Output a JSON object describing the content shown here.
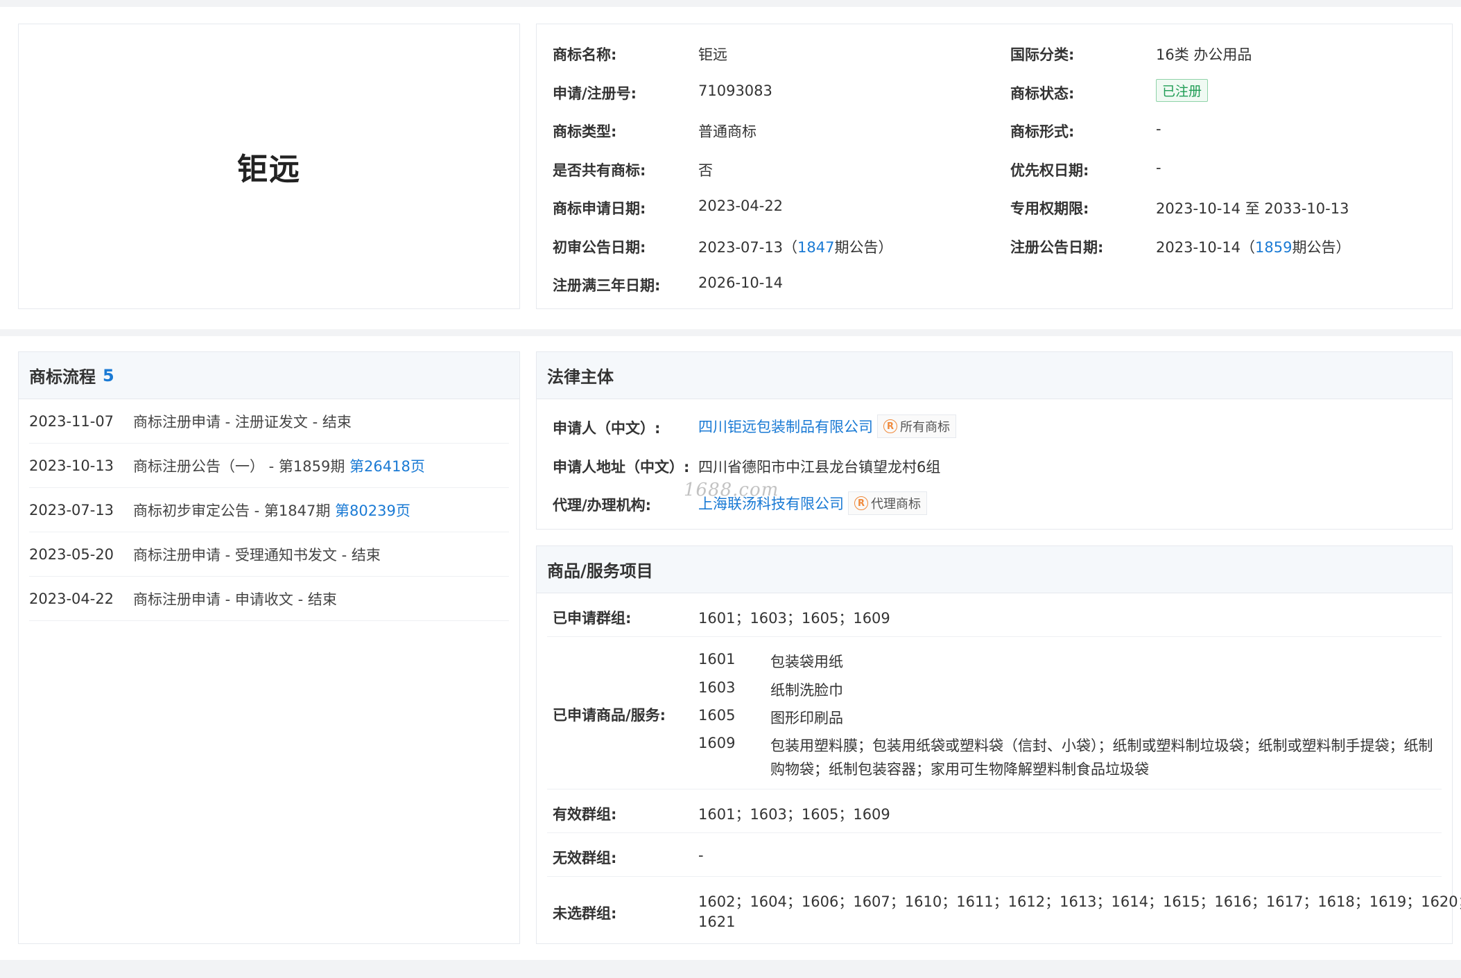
{
  "logo": {
    "text": "钜远"
  },
  "basic_info": {
    "left": [
      {
        "label": "商标名称:",
        "value": "钜远"
      },
      {
        "label": "申请/注册号:",
        "value": "71093083"
      },
      {
        "label": "商标类型:",
        "value": "普通商标"
      },
      {
        "label": "是否共有商标:",
        "value": "否"
      },
      {
        "label": "商标申请日期:",
        "value": "2023-04-22"
      },
      {
        "label": "初审公告日期:",
        "value_prefix": "2023-07-13（",
        "link": "1847",
        "value_suffix": "期公告）"
      },
      {
        "label": "注册满三年日期:",
        "value": "2026-10-14"
      }
    ],
    "right": [
      {
        "label": "国际分类:",
        "value": "16类 办公用品"
      },
      {
        "label": "商标状态:",
        "badge": "已注册"
      },
      {
        "label": "商标形式:",
        "value": "-"
      },
      {
        "label": "优先权日期:",
        "value": "-"
      },
      {
        "label": "专用权期限:",
        "value": "2023-10-14 至 2033-10-13"
      },
      {
        "label": "注册公告日期:",
        "value_prefix": "2023-10-14（",
        "link": "1859",
        "value_suffix": "期公告）"
      }
    ]
  },
  "flow": {
    "title": "商标流程",
    "count": "5",
    "items": [
      {
        "date": "2023-11-07",
        "desc": "商标注册申请 - 注册证发文 - 结束",
        "link": ""
      },
      {
        "date": "2023-10-13",
        "desc": "商标注册公告（一） - 第1859期 ",
        "link": "第26418页"
      },
      {
        "date": "2023-07-13",
        "desc": "商标初步审定公告 - 第1847期 ",
        "link": "第80239页"
      },
      {
        "date": "2023-05-20",
        "desc": "商标注册申请 - 受理通知书发文 - 结束",
        "link": ""
      },
      {
        "date": "2023-04-22",
        "desc": "商标注册申请 - 申请收文 - 结束",
        "link": ""
      }
    ]
  },
  "legal": {
    "title": "法律主体",
    "applicant_label": "申请人（中文）:",
    "applicant_value": "四川钜远包装制品有限公司",
    "applicant_tag": "所有商标",
    "address_label": "申请人地址（中文）:",
    "address_value": "四川省德阳市中江县龙台镇望龙村6组",
    "agent_label": "代理/办理机构:",
    "agent_value": "上海联汤科技有限公司",
    "agent_tag": "代理商标",
    "watermark": "1688.com"
  },
  "goods": {
    "title": "商品/服务项目",
    "applied_groups_label": "已申请群组:",
    "applied_groups_value": "1601；1603；1605；1609",
    "applied_goods_label": "已申请商品/服务:",
    "applied_goods": [
      {
        "code": "1601",
        "name": "包装袋用纸"
      },
      {
        "code": "1603",
        "name": "纸制洗脸巾"
      },
      {
        "code": "1605",
        "name": "图形印刷品"
      },
      {
        "code": "1609",
        "name_line1": "包装用塑料膜；包装用纸袋或塑料袋（信封、小袋）；纸制或塑料制垃圾袋；纸制或塑料制手提袋；纸制",
        "name_line2": "购物袋；纸制包装容器；家用可生物降解塑料制食品垃圾袋"
      }
    ],
    "valid_groups_label": "有效群组:",
    "valid_groups_value": "1601；1603；1605；1609",
    "invalid_groups_label": "无效群组:",
    "invalid_groups_value": "-",
    "unselected_groups_label": "未选群组:",
    "unselected_line1": "1602；1604；1606；1607；1610；1611；1612；1613；1614；1615；1616；1617；1618；1619；1620；",
    "unselected_line2": "1621"
  }
}
